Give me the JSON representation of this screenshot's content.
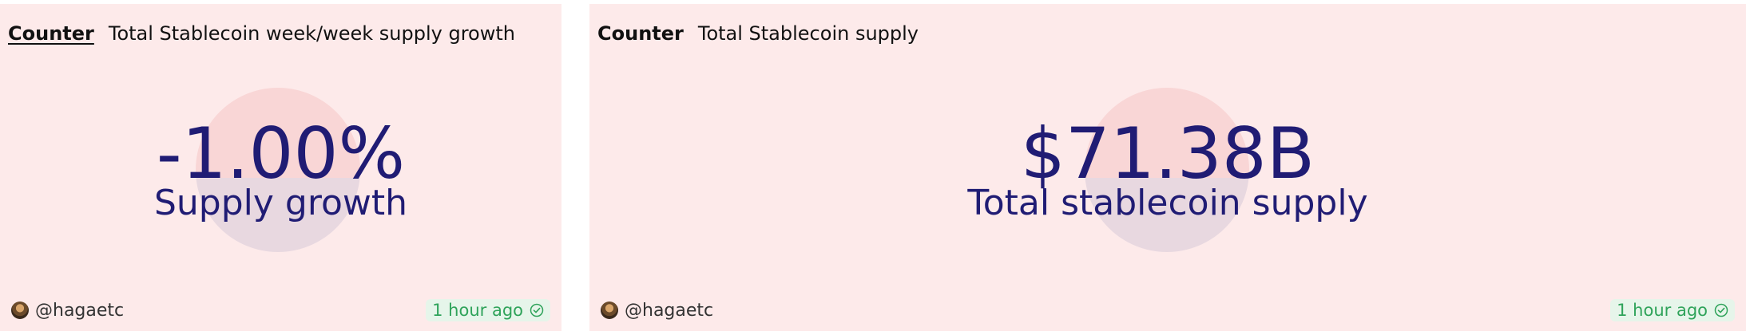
{
  "cards": [
    {
      "type": "Counter",
      "title": "Total Stablecoin week/week supply growth",
      "value": "-1.00%",
      "label": "Supply growth",
      "author": "@hagaetc",
      "updated": "1 hour ago",
      "icons": [
        "avatar-icon",
        "check-circle-icon"
      ]
    },
    {
      "type": "Counter",
      "title": "Total Stablecoin supply",
      "value": "$71.38B",
      "label": "Total stablecoin supply",
      "author": "@hagaetc",
      "updated": "1 hour ago",
      "icons": [
        "avatar-icon",
        "check-circle-icon"
      ]
    }
  ],
  "colors": {
    "card_background": "#fdeaea",
    "value_text": "#201c74",
    "freshness_green": "#2fa35a",
    "freshness_background": "#e6f5ea"
  }
}
